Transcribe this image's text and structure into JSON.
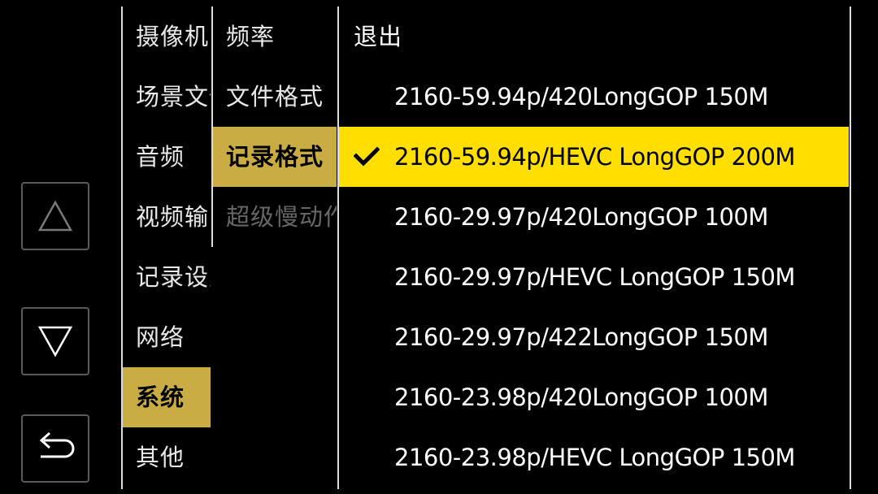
{
  "nav": {
    "up_icon": "triangle-up-icon",
    "down_icon": "triangle-down-icon",
    "back_icon": "return-arrow-icon"
  },
  "menu": {
    "items": [
      {
        "label": "摄像机"
      },
      {
        "label": "场景文件"
      },
      {
        "label": "音频"
      },
      {
        "label": "视频输出"
      },
      {
        "label": "记录设置"
      },
      {
        "label": "网络"
      },
      {
        "label": "系统",
        "active": true
      },
      {
        "label": "其他"
      }
    ]
  },
  "submenu": {
    "items": [
      {
        "label": "频率"
      },
      {
        "label": "文件格式"
      },
      {
        "label": "记录格式",
        "active": true
      },
      {
        "label": "超级慢动作",
        "disabled": true
      }
    ]
  },
  "options": {
    "exit_label": "退出",
    "items": [
      {
        "label": "2160-59.94p/420LongGOP 150M"
      },
      {
        "label": "2160-59.94p/HEVC LongGOP 200M",
        "selected": true
      },
      {
        "label": "2160-29.97p/420LongGOP 100M"
      },
      {
        "label": "2160-29.97p/HEVC LongGOP 150M"
      },
      {
        "label": "2160-29.97p/422LongGOP 150M"
      },
      {
        "label": "2160-23.98p/420LongGOP 100M"
      },
      {
        "label": "2160-23.98p/HEVC LongGOP 150M"
      }
    ],
    "check_icon": "checkmark-icon"
  },
  "colors": {
    "menu_active": "#c9ac44",
    "option_selected": "#ffde00",
    "background": "#000000"
  }
}
